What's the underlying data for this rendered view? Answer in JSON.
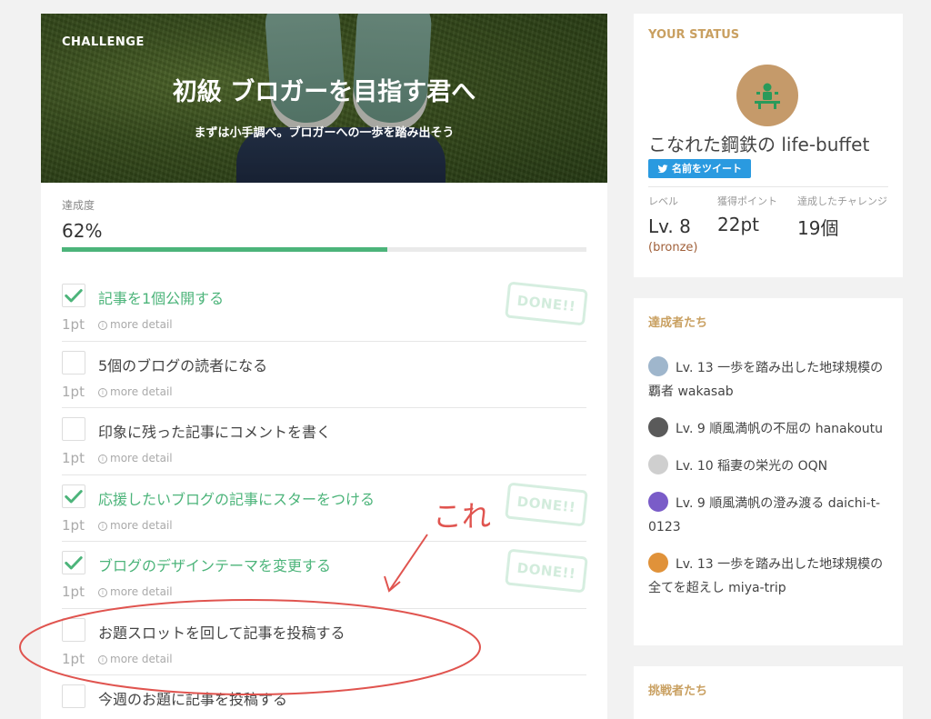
{
  "colors": {
    "accent_green": "#4cb47a",
    "sidebar_heading": "#c9a061",
    "annotation_red": "#e0544f",
    "twitter_blue": "#2a9ae0"
  },
  "challenge": {
    "tag": "CHALLENGE",
    "title": "初級 ブロガーを目指す君へ",
    "subtitle": "まずは小手調べ。ブロガーへの一歩を踏み出そう"
  },
  "progress": {
    "label": "達成度",
    "value_text": "62%",
    "fraction": 0.62
  },
  "tasks": [
    {
      "label": "記事を1個公開する",
      "points": "1pt",
      "detail": "more detail",
      "done": true,
      "stamp": "DONE!!"
    },
    {
      "label": "5個のブログの読者になる",
      "points": "1pt",
      "detail": "more detail",
      "done": false
    },
    {
      "label": "印象に残った記事にコメントを書く",
      "points": "1pt",
      "detail": "more detail",
      "done": false
    },
    {
      "label": "応援したいブログの記事にスターをつける",
      "points": "1pt",
      "detail": "more detail",
      "done": true,
      "stamp": "DONE!!"
    },
    {
      "label": "ブログのデザインテーマを変更する",
      "points": "1pt",
      "detail": "more detail",
      "done": true,
      "stamp": "DONE!!"
    },
    {
      "label": "お題スロットを回して記事を投稿する",
      "points": "1pt",
      "detail": "more detail",
      "done": false
    },
    {
      "label": "今週のお題に記事を投稿する",
      "points": "1pt",
      "detail": "more detail",
      "done": false
    }
  ],
  "annotation": {
    "text": "これ"
  },
  "status": {
    "heading": "YOUR STATUS",
    "user_name": "こなれた鋼鉄の life-buffet",
    "tweet_label": "名前をツイート",
    "level_label": "レベル",
    "level_value": "Lv. 8",
    "level_rank": "(bronze)",
    "points_label": "獲得ポイント",
    "points_value": "22pt",
    "challenges_label": "達成したチャレンジ",
    "challenges_value": "19個"
  },
  "achievers": {
    "heading": "達成者たち",
    "items": [
      {
        "text": "Lv. 13 一歩を踏み出した地球規模の覇者 wakasab",
        "avatar_color": "#9fb6cc"
      },
      {
        "text": "Lv. 9 順風満帆の不屈の hanakoutu",
        "avatar_color": "#5a5a5a"
      },
      {
        "text": "Lv. 10 稲妻の栄光の OQN",
        "avatar_color": "#cfcfcf"
      },
      {
        "text": "Lv. 9 順風満帆の澄み渡る daichi-t-0123",
        "avatar_color": "#7a5cc8"
      },
      {
        "text": "Lv. 13 一歩を踏み出した地球規模の全てを超えし miya-trip",
        "avatar_color": "#e0923a"
      }
    ]
  },
  "challengers": {
    "heading": "挑戦者たち"
  }
}
